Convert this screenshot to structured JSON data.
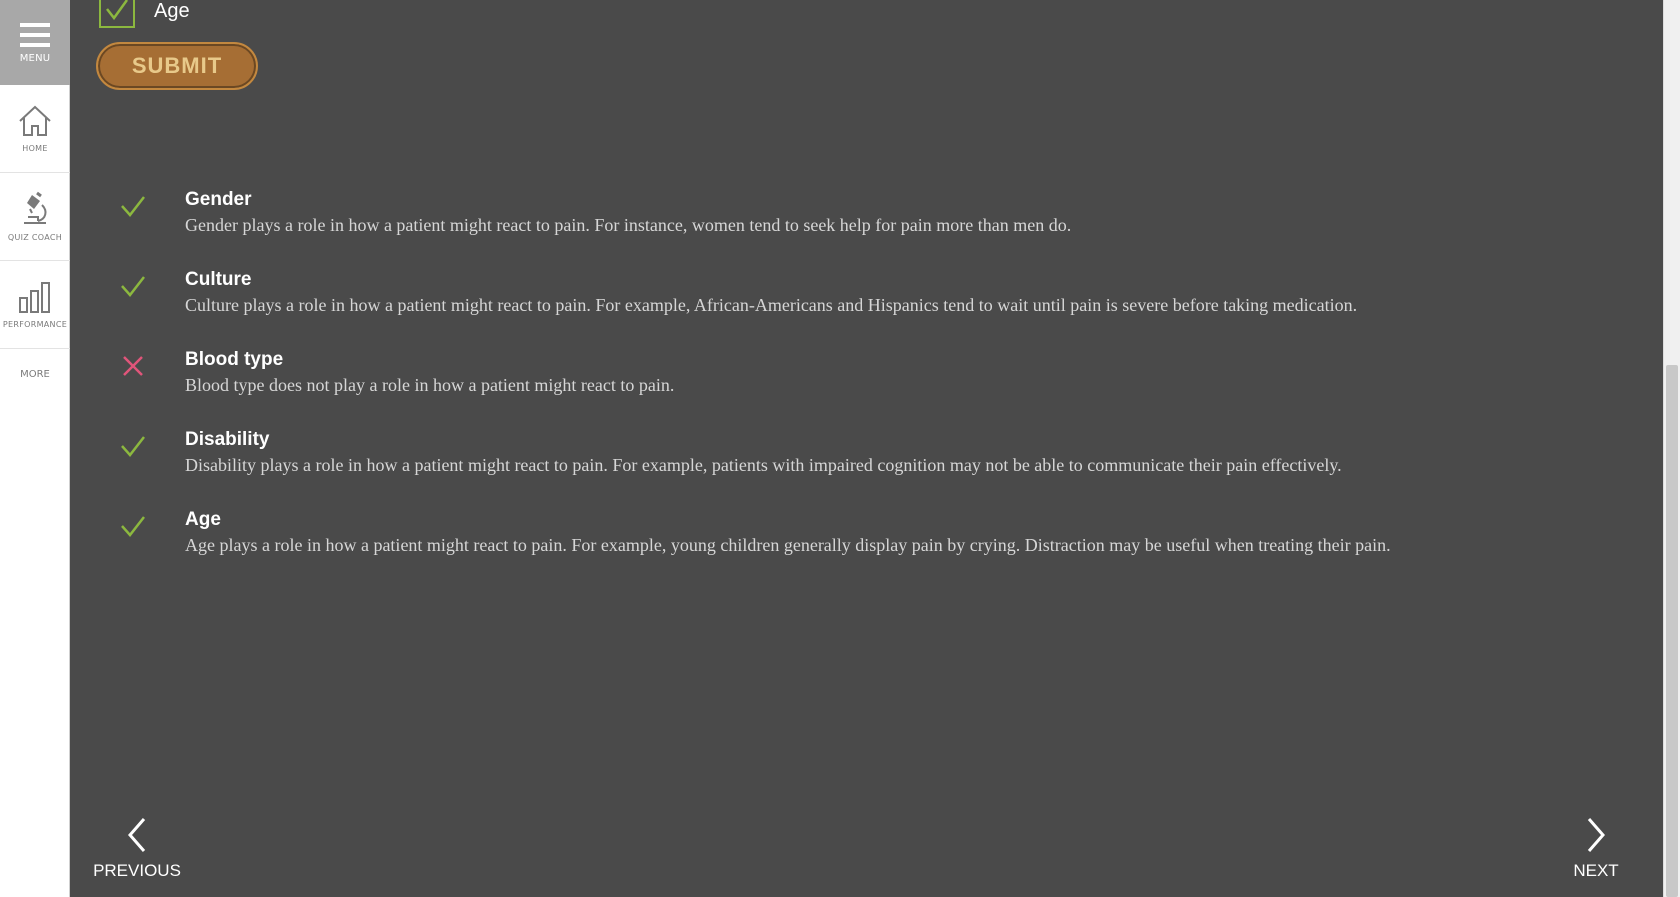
{
  "sidebar": {
    "menu_label": "MENU",
    "items": [
      {
        "label": "HOME",
        "icon": "home-icon"
      },
      {
        "label": "QUIZ COACH",
        "icon": "microscope-icon"
      },
      {
        "label": "PERFORMANCE",
        "icon": "bar-chart-icon"
      }
    ],
    "more_label": "MORE"
  },
  "question": {
    "visible_option_label": "Age",
    "submit_label": "SUBMIT"
  },
  "feedback": [
    {
      "status": "correct",
      "title": "Gender",
      "text": "Gender plays a role in how a patient might react to pain. For instance, women tend to seek help for pain more than men do."
    },
    {
      "status": "correct",
      "title": "Culture",
      "text": "Culture plays a role in how a patient might react to pain. For example, African-Americans and Hispanics tend to wait until pain is severe before taking medication."
    },
    {
      "status": "incorrect",
      "title": "Blood type",
      "text": "Blood type does not play a role in how a patient might react to pain."
    },
    {
      "status": "correct",
      "title": "Disability",
      "text": "Disability plays a role in how a patient might react to pain. For example, patients with impaired cognition may not be able to communicate their pain effectively."
    },
    {
      "status": "correct",
      "title": "Age",
      "text": "Age plays a role in how a patient might react to pain. For example, young children generally display pain by crying. Distraction may be useful when treating their pain."
    }
  ],
  "navigation": {
    "previous_label": "PREVIOUS",
    "next_label": "NEXT"
  },
  "colors": {
    "correct": "#8cb83f",
    "incorrect": "#e0557a",
    "submit": "#a66e34",
    "background": "#4a4a4a"
  }
}
